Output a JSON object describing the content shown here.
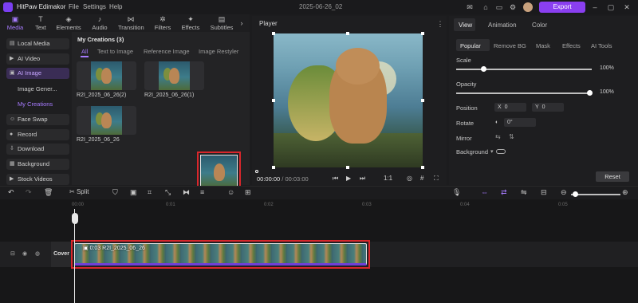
{
  "app": {
    "name": "HitPaw Edimakor",
    "doc_title": "2025-06-26_02",
    "export_label": "Export"
  },
  "menu": [
    "File",
    "Settings",
    "Help"
  ],
  "toolbar": {
    "items": [
      {
        "label": "Media",
        "icon": "media-icon"
      },
      {
        "label": "Text",
        "icon": "text-icon"
      },
      {
        "label": "Elements",
        "icon": "elements-icon"
      },
      {
        "label": "Audio",
        "icon": "audio-icon"
      },
      {
        "label": "Transition",
        "icon": "transition-icon"
      },
      {
        "label": "Filters",
        "icon": "filters-icon"
      },
      {
        "label": "Effects",
        "icon": "effects-icon"
      },
      {
        "label": "Subtitles",
        "icon": "subtitles-icon"
      }
    ]
  },
  "sidebar": {
    "items": [
      {
        "label": "Local Media"
      },
      {
        "label": "AI Video"
      },
      {
        "label": "AI Image"
      },
      {
        "label": "Image Gener..."
      },
      {
        "label": "My Creations"
      },
      {
        "label": "Face Swap"
      },
      {
        "label": "Record"
      },
      {
        "label": "Download"
      },
      {
        "label": "Background"
      },
      {
        "label": "Stock Videos"
      }
    ]
  },
  "creations": {
    "title": "My Creations (3)",
    "tabs": [
      "All",
      "Text to Image",
      "Reference Image",
      "Image Restyler"
    ],
    "items": [
      "R2I_2025_06_26(2)",
      "R2I_2025_06_26(1)",
      "R2I_2025_06_26"
    ]
  },
  "player": {
    "title": "Player",
    "current_time": "00:00:00",
    "total_time": "/ 00:03:00",
    "ratio": "1:1"
  },
  "properties": {
    "tabs": [
      "View",
      "Animation",
      "Color"
    ],
    "subtabs": [
      "Popular",
      "Remove BG",
      "Mask",
      "Effects",
      "AI Tools"
    ],
    "scale_label": "Scale",
    "scale_value": "100%",
    "scale": 1.0,
    "opacity_label": "Opacity",
    "opacity_value": "100%",
    "opacity": 1.0,
    "position_label": "Position",
    "pos_x_label": "X",
    "pos_x": "0",
    "pos_y_label": "Y",
    "pos_y": "0",
    "rotate_label": "Rotate",
    "rotate_value": "0°",
    "mirror_label": "Mirror",
    "background_label": "Background",
    "reset_label": "Reset"
  },
  "timeline": {
    "split_label": "Split",
    "ruler": [
      "00:00",
      "0:01",
      "0:02",
      "0:03",
      "0:04",
      "0:05"
    ],
    "cover_label": "Cover",
    "clip_duration": "0:03",
    "clip_name": "R2I_2025_06_26"
  },
  "colors": {
    "accent": "#8a3ff0",
    "highlight": "#d9262b"
  }
}
